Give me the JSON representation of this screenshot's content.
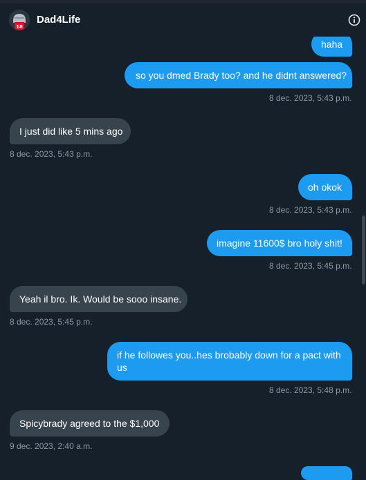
{
  "header": {
    "title": "Dad4Life",
    "avatar_icon": "avatar-helmet-icon",
    "info_icon": "info-icon"
  },
  "messages": [
    {
      "dir": "out",
      "text": "haha",
      "timestamp": ""
    },
    {
      "dir": "out",
      "text": "so you dmed Brady too? and he didnt answered?",
      "timestamp": "8 dec. 2023, 5:43 p.m."
    },
    {
      "dir": "in",
      "text": "I just did like 5 mins ago",
      "timestamp": "8 dec. 2023, 5:43 p.m."
    },
    {
      "dir": "out",
      "text": "oh okok",
      "timestamp": "8 dec. 2023, 5:43 p.m."
    },
    {
      "dir": "out",
      "text": "imagine 11600$ bro holy shit!",
      "timestamp": "8 dec. 2023, 5:45 p.m."
    },
    {
      "dir": "in",
      "text": "Yeah il bro. Ik. Would be sooo insane.",
      "timestamp": "8 dec. 2023, 5:45 p.m."
    },
    {
      "dir": "out",
      "text": "if he followes you..hes brobably down for a pact with us",
      "timestamp": "8 dec. 2023, 5:48 p.m."
    },
    {
      "dir": "in",
      "text": "Spicybrady agreed to the $1,000",
      "timestamp": "9 dec. 2023, 2:40 a.m."
    }
  ],
  "colors": {
    "background": "#15202b",
    "outgoing": "#1d9bf0",
    "incoming": "#38444d",
    "timestamp": "#8b98a5"
  }
}
